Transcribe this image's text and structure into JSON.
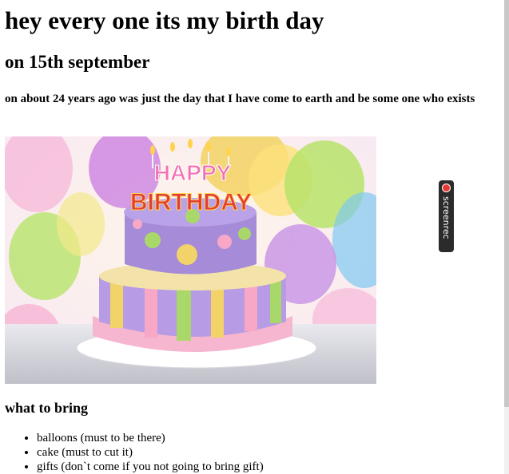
{
  "heading": "hey every one its my birth day",
  "subheading": "on 15th september",
  "intro": "on about 24 years ago was just the day that I have come to earth and be some one who exists",
  "image": {
    "icon": "birthday-cake-image",
    "topper_line1": "HAPPY",
    "topper_line2": "BIRTHDAY"
  },
  "bring": {
    "title": "what to bring",
    "items": [
      "balloons (must to be there)",
      "cake (must to cut it)",
      "gifts (don`t come if you not going to bring gift)"
    ]
  },
  "overlay": {
    "recorder_label": "screenrec",
    "recorder_icon": "record-dot-icon",
    "dot_color": "#e53935"
  }
}
